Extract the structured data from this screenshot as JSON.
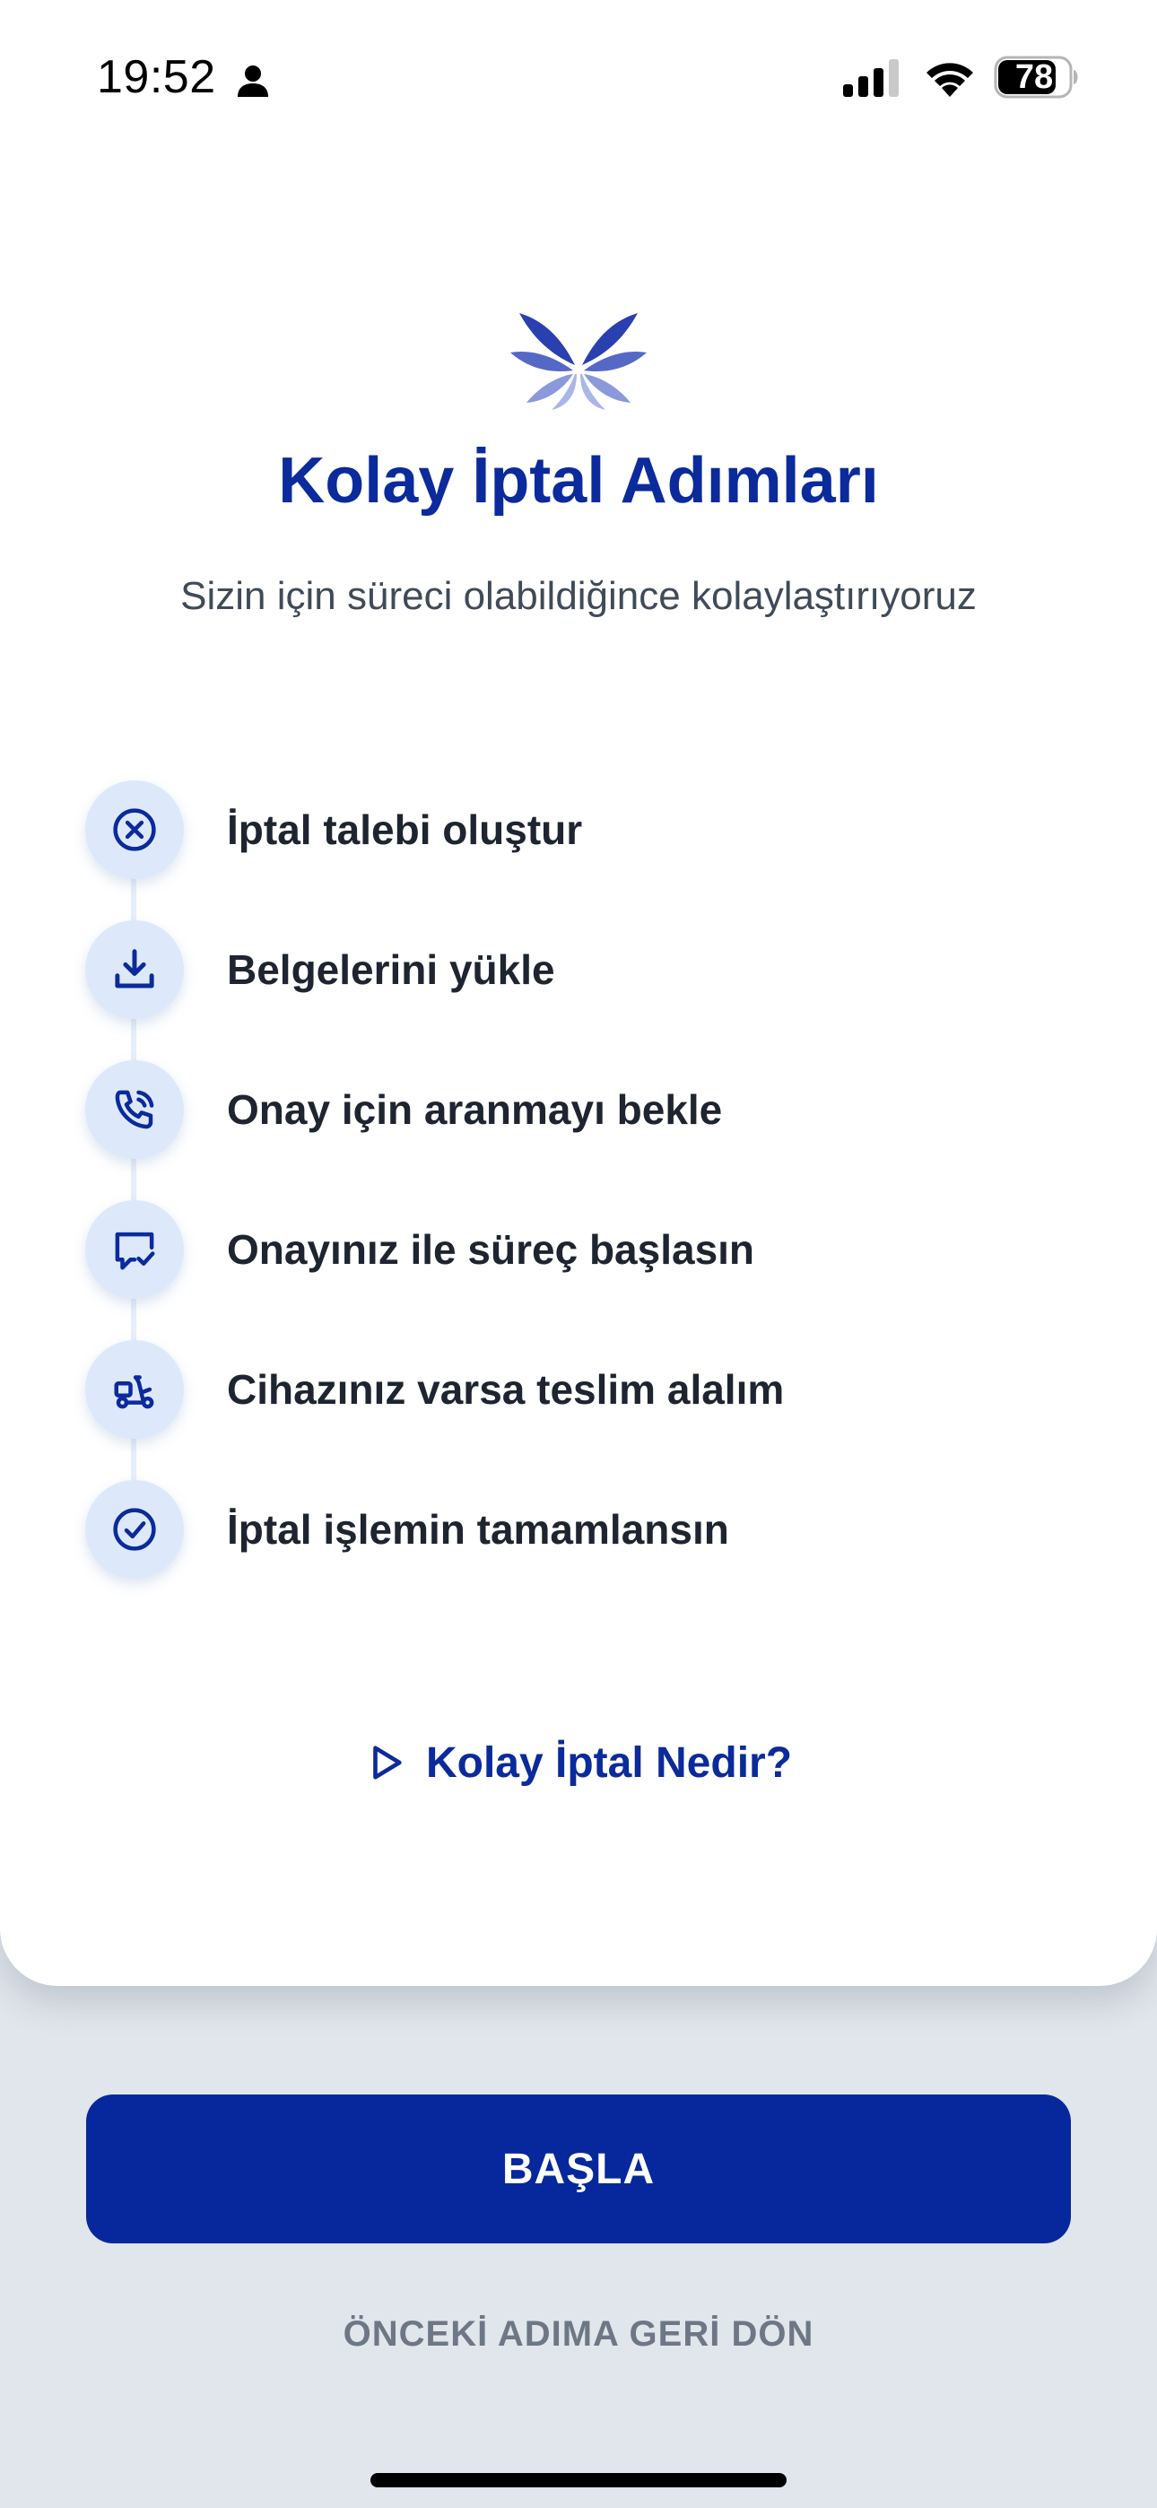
{
  "status_bar": {
    "time": "19:52",
    "battery": "78",
    "icons": [
      "person-icon",
      "cellular-signal-icon",
      "wifi-icon",
      "battery-icon"
    ]
  },
  "header": {
    "logo_icon": "butterfly-logo-icon",
    "title": "Kolay İptal Adımları",
    "subtitle": "Sizin için süreci olabildiğince kolaylaştırıyoruz"
  },
  "steps": [
    {
      "icon": "cancel-circle-icon",
      "label": "İptal talebi oluştur"
    },
    {
      "icon": "download-icon",
      "label": "Belgelerini yükle"
    },
    {
      "icon": "phone-call-icon",
      "label": "Onay için aranmayı bekle"
    },
    {
      "icon": "message-check-icon",
      "label": "Onayınız ile süreç başlasın"
    },
    {
      "icon": "courier-scooter-icon",
      "label": "Cihazınız varsa teslim alalım"
    },
    {
      "icon": "check-circle-icon",
      "label": "İptal işlemin tamamlansın"
    }
  ],
  "info_link": {
    "icon": "play-icon",
    "label": "Kolay İptal Nedir?"
  },
  "actions": {
    "start_label": "BAŞLA",
    "back_label": "ÖNCEKİ ADIMA GERİ DÖN"
  },
  "colors": {
    "brand": "#0b2a9c",
    "button": "#06289c",
    "step_circle": "#dde9fb",
    "background": "#e1e6ec"
  }
}
